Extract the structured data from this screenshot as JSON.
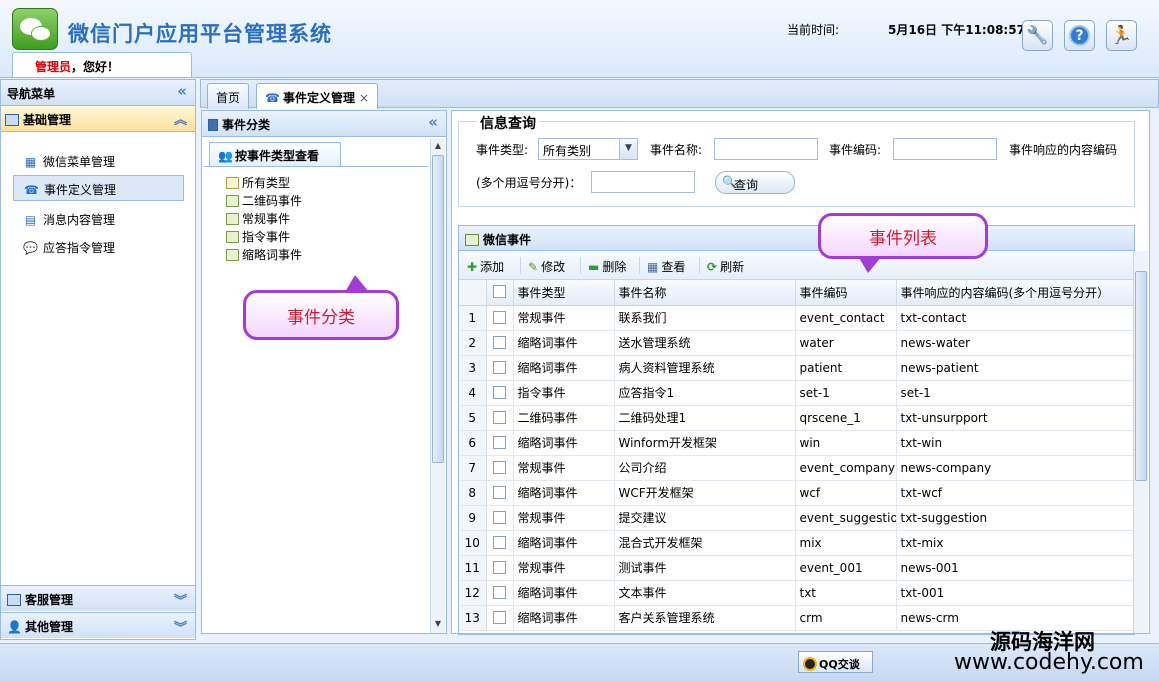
{
  "header": {
    "app_title": "微信门户应用平台管理系统",
    "role": "管理员",
    "greeting": "，您好！",
    "time_label": "当前时间:",
    "time_value": "5月16日 下午11:08:57"
  },
  "nav": {
    "title": "导航菜单",
    "group_basic": "基础管理",
    "items": [
      {
        "label": "微信菜单管理",
        "icon": "menu-tree-icon"
      },
      {
        "label": "事件定义管理",
        "icon": "phone-icon"
      },
      {
        "label": "消息内容管理",
        "icon": "message-doc-icon"
      },
      {
        "label": "应答指令管理",
        "icon": "speech-bubble-icon"
      }
    ],
    "group_service": "客服管理",
    "group_other": "其他管理"
  },
  "tabs": [
    {
      "label": "首页"
    },
    {
      "label": "事件定义管理",
      "close": "×"
    }
  ],
  "category": {
    "title": "事件分类",
    "tab": "按事件类型查看",
    "tree": [
      "所有类型",
      "二维码事件",
      "常规事件",
      "指令事件",
      "缩略词事件"
    ]
  },
  "query": {
    "legend": "信息查询",
    "type_label": "事件类型:",
    "type_value": "所有类别",
    "name_label": "事件名称:",
    "code_label": "事件编码:",
    "resp_label": "事件响应的内容编码",
    "resp_label2": "(多个用逗号分开)：",
    "search_button": "查询"
  },
  "grid": {
    "title": "微信事件",
    "toolbar": {
      "add": "添加",
      "edit": "修改",
      "delete": "删除",
      "view": "查看",
      "refresh": "刷新"
    },
    "columns": [
      "事件类型",
      "事件名称",
      "事件编码",
      "事件响应的内容编码(多个用逗号分开）"
    ],
    "rows": [
      {
        "n": "1",
        "type": "常规事件",
        "name": "联系我们",
        "code": "event_contact",
        "resp": "txt-contact"
      },
      {
        "n": "2",
        "type": "缩略词事件",
        "name": "送水管理系统",
        "code": "water",
        "resp": "news-water"
      },
      {
        "n": "3",
        "type": "缩略词事件",
        "name": "病人资料管理系统",
        "code": "patient",
        "resp": "news-patient"
      },
      {
        "n": "4",
        "type": "指令事件",
        "name": "应答指令1",
        "code": "set-1",
        "resp": "set-1"
      },
      {
        "n": "5",
        "type": "二维码事件",
        "name": "二维码处理1",
        "code": "qrscene_1",
        "resp": "txt-unsurpport"
      },
      {
        "n": "6",
        "type": "缩略词事件",
        "name": "Winform开发框架",
        "code": "win",
        "resp": "txt-win"
      },
      {
        "n": "7",
        "type": "常规事件",
        "name": "公司介绍",
        "code": "event_company",
        "resp": "news-company"
      },
      {
        "n": "8",
        "type": "缩略词事件",
        "name": "WCF开发框架",
        "code": "wcf",
        "resp": "txt-wcf"
      },
      {
        "n": "9",
        "type": "常规事件",
        "name": "提交建议",
        "code": "event_suggestion",
        "resp": "txt-suggestion"
      },
      {
        "n": "10",
        "type": "缩略词事件",
        "name": "混合式开发框架",
        "code": "mix",
        "resp": "txt-mix"
      },
      {
        "n": "11",
        "type": "常规事件",
        "name": "测试事件",
        "code": "event_001",
        "resp": "news-001"
      },
      {
        "n": "12",
        "type": "缩略词事件",
        "name": "文本事件",
        "code": "txt",
        "resp": "txt-001"
      },
      {
        "n": "13",
        "type": "缩略词事件",
        "name": "客户关系管理系统",
        "code": "crm",
        "resp": "news-crm"
      }
    ]
  },
  "callouts": {
    "category": "事件分类",
    "list": "事件列表"
  },
  "footer": {
    "qq": "QQ交谈"
  },
  "watermark": {
    "line1": "源码海洋网",
    "line2": "www.codehy.com"
  },
  "colors": {
    "accent": "#2a6fc0",
    "border": "#99bbe8",
    "callout_border": "#a33bd6",
    "callout_text": "#d41a2a"
  }
}
